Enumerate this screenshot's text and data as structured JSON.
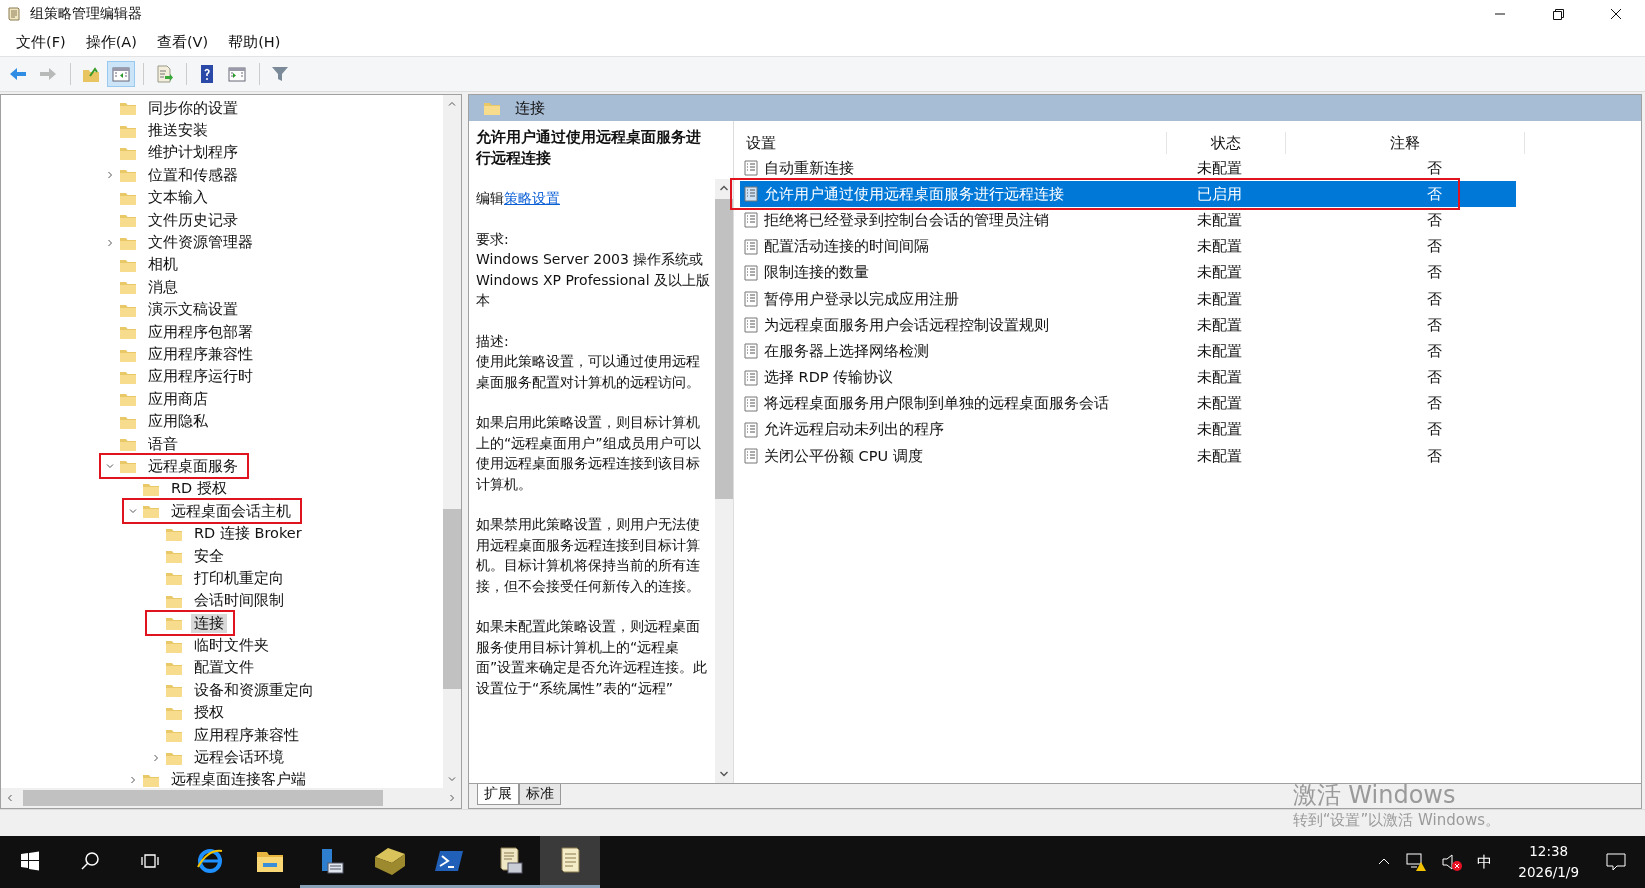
{
  "window": {
    "title": "组策略管理编辑器"
  },
  "menu": [
    "文件(F)",
    "操作(A)",
    "查看(V)",
    "帮助(H)"
  ],
  "toolbar": [
    [
      {
        "kind": "back",
        "disabled": false,
        "pressed": false
      },
      {
        "kind": "forward",
        "disabled": true,
        "pressed": false
      }
    ],
    [
      {
        "kind": "up",
        "disabled": false,
        "pressed": false
      },
      {
        "kind": "tree",
        "disabled": false,
        "pressed": true
      }
    ],
    [
      {
        "kind": "export",
        "disabled": false,
        "pressed": false
      }
    ],
    [
      {
        "kind": "help",
        "disabled": false,
        "pressed": false
      },
      {
        "kind": "pane",
        "disabled": false,
        "pressed": false
      }
    ],
    [
      {
        "kind": "filter",
        "disabled": false,
        "pressed": false
      }
    ]
  ],
  "tree": {
    "items": [
      {
        "label": "同步你的设置",
        "selected": false,
        "marked": false
      },
      {
        "label": "推送安装",
        "selected": false,
        "marked": false
      },
      {
        "label": "维护计划程序",
        "selected": false,
        "marked": false
      },
      {
        "label": "位置和传感器",
        "selected": false,
        "marked": false,
        "expanded": false
      },
      {
        "label": "文本输入",
        "selected": false,
        "marked": false
      },
      {
        "label": "文件历史记录",
        "selected": false,
        "marked": false
      },
      {
        "label": "文件资源管理器",
        "selected": false,
        "marked": false,
        "expanded": false
      },
      {
        "label": "相机",
        "selected": false,
        "marked": false
      },
      {
        "label": "消息",
        "selected": false,
        "marked": false
      },
      {
        "label": "演示文稿设置",
        "selected": false,
        "marked": false
      },
      {
        "label": "应用程序包部署",
        "selected": false,
        "marked": false
      },
      {
        "label": "应用程序兼容性",
        "selected": false,
        "marked": false
      },
      {
        "label": "应用程序运行时",
        "selected": false,
        "marked": false
      },
      {
        "label": "应用商店",
        "selected": false,
        "marked": false
      },
      {
        "label": "应用隐私",
        "selected": false,
        "marked": false
      },
      {
        "label": "语音",
        "selected": false,
        "marked": false
      },
      {
        "label": "远程桌面服务",
        "selected": false,
        "marked": true,
        "expanded": true,
        "children": [
          {
            "label": "RD 授权",
            "selected": false,
            "marked": false
          },
          {
            "label": "远程桌面会话主机",
            "selected": false,
            "marked": true,
            "expanded": true,
            "children": [
              {
                "label": "RD 连接 Broker",
                "selected": false,
                "marked": false
              },
              {
                "label": "安全",
                "selected": false,
                "marked": false
              },
              {
                "label": "打印机重定向",
                "selected": false,
                "marked": false
              },
              {
                "label": "会话时间限制",
                "selected": false,
                "marked": false
              },
              {
                "label": "连接",
                "selected": true,
                "marked": true
              },
              {
                "label": "临时文件夹",
                "selected": false,
                "marked": false
              },
              {
                "label": "配置文件",
                "selected": false,
                "marked": false
              },
              {
                "label": "设备和资源重定向",
                "selected": false,
                "marked": false
              },
              {
                "label": "授权",
                "selected": false,
                "marked": false
              },
              {
                "label": "应用程序兼容性",
                "selected": false,
                "marked": false
              },
              {
                "label": "远程会话环境",
                "selected": false,
                "marked": false,
                "expanded": false
              }
            ]
          },
          {
            "label": "远程桌面连接客户端",
            "selected": false,
            "marked": false,
            "expanded": false
          }
        ]
      }
    ]
  },
  "detail": {
    "folder": "连接",
    "title": "允许用户通过使用远程桌面服务进行远程连接",
    "edit_prefix": "编辑",
    "edit_link": "策略设置",
    "blocks": [
      {
        "heading": "要求:",
        "text": "Windows Server 2003 操作系统或 Windows XP Professional 及以上版本"
      },
      {
        "heading": "描述:",
        "text": "使用此策略设置，可以通过使用远程桌面服务配置对计算机的远程访问。"
      },
      {
        "text": "如果启用此策略设置，则目标计算机上的“远程桌面用户”组成员用户可以使用远程桌面服务远程连接到该目标计算机。"
      },
      {
        "text": "如果禁用此策略设置，则用户无法使用远程桌面服务远程连接到目标计算机。目标计算机将保持当前的所有连接，但不会接受任何新传入的连接。"
      },
      {
        "text": "如果未配置此策略设置，则远程桌面服务使用目标计算机上的“远程桌面”设置来确定是否允许远程连接。此设置位于“系统属性”表的“远程”"
      }
    ]
  },
  "list": {
    "columns": [
      "设置",
      "状态",
      "注释"
    ],
    "rows": [
      {
        "name": "自动重新连接",
        "state": "未配置",
        "comment": "否",
        "selected": false,
        "marked": false
      },
      {
        "name": "允许用户通过使用远程桌面服务进行远程连接",
        "state": "已启用",
        "comment": "否",
        "selected": true,
        "marked": true
      },
      {
        "name": "拒绝将已经登录到控制台会话的管理员注销",
        "state": "未配置",
        "comment": "否",
        "selected": false,
        "marked": false
      },
      {
        "name": "配置活动连接的时间间隔",
        "state": "未配置",
        "comment": "否",
        "selected": false,
        "marked": false
      },
      {
        "name": "限制连接的数量",
        "state": "未配置",
        "comment": "否",
        "selected": false,
        "marked": false
      },
      {
        "name": "暂停用户登录以完成应用注册",
        "state": "未配置",
        "comment": "否",
        "selected": false,
        "marked": false
      },
      {
        "name": "为远程桌面服务用户会话远程控制设置规则",
        "state": "未配置",
        "comment": "否",
        "selected": false,
        "marked": false
      },
      {
        "name": "在服务器上选择网络检测",
        "state": "未配置",
        "comment": "否",
        "selected": false,
        "marked": false
      },
      {
        "name": "选择 RDP 传输协议",
        "state": "未配置",
        "comment": "否",
        "selected": false,
        "marked": false
      },
      {
        "name": "将远程桌面服务用户限制到单独的远程桌面服务会话",
        "state": "未配置",
        "comment": "否",
        "selected": false,
        "marked": false
      },
      {
        "name": "允许远程启动未列出的程序",
        "state": "未配置",
        "comment": "否",
        "selected": false,
        "marked": false
      },
      {
        "name": "关闭公平份额 CPU 调度",
        "state": "未配置",
        "comment": "否",
        "selected": false,
        "marked": false
      }
    ]
  },
  "view_tabs": [
    {
      "label": "扩展",
      "selected": true
    },
    {
      "label": "标准",
      "selected": false
    }
  ],
  "activation": {
    "title": "激活 Windows",
    "hint": "转到“设置”以激活 Windows。"
  },
  "taskbar": {
    "apps": [
      {
        "kind": "browser",
        "running": false,
        "selected": false
      },
      {
        "kind": "folder",
        "running": false,
        "selected": false
      },
      {
        "kind": "server",
        "running": true,
        "selected": false
      },
      {
        "kind": "drive",
        "running": true,
        "selected": false
      },
      {
        "kind": "shell",
        "running": true,
        "selected": false
      },
      {
        "kind": "policy",
        "running": true,
        "selected": false
      },
      {
        "kind": "notepad",
        "running": true,
        "selected": true
      }
    ],
    "ime": "中",
    "time": "12:38",
    "date": "2026/1/9"
  }
}
